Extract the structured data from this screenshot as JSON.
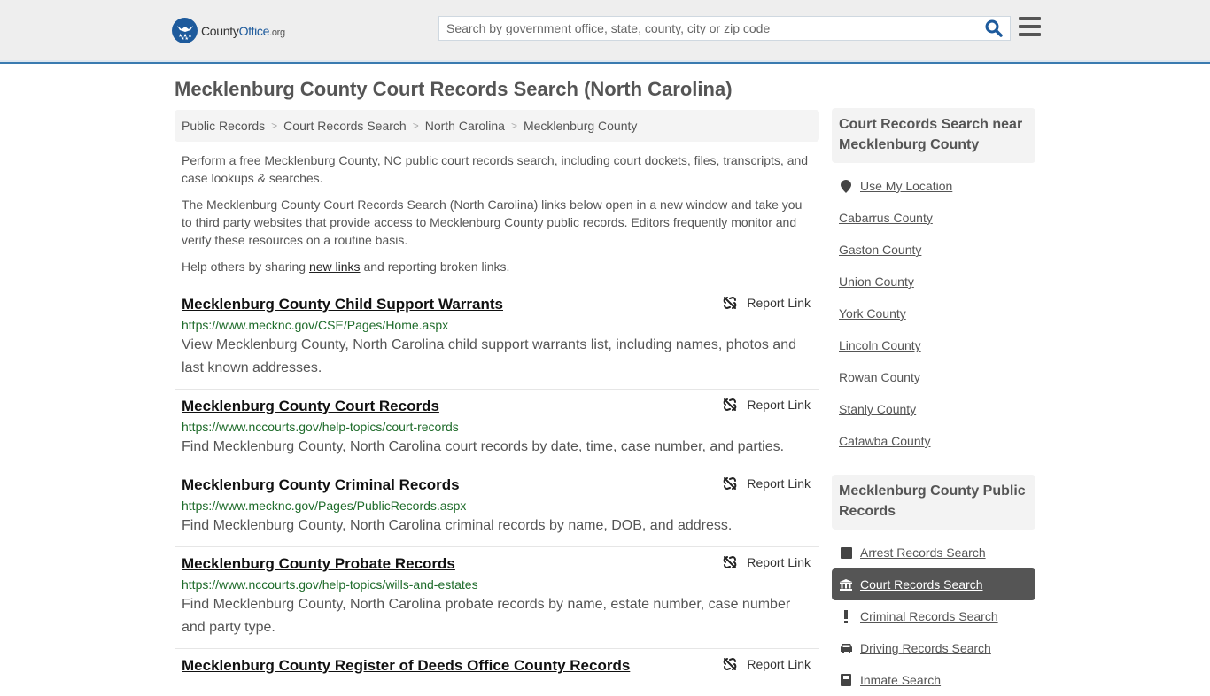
{
  "header": {
    "logo": {
      "name": "County",
      "name_accent": "Office",
      "tld": ".org"
    },
    "search": {
      "placeholder": "Search by government office, state, county, city or zip code",
      "value": ""
    },
    "colors": {
      "brand": "#1d5a9c",
      "header_border": "#3a7bb0"
    }
  },
  "page": {
    "title": "Mecklenburg County Court Records Search (North Carolina)"
  },
  "breadcrumb": [
    {
      "label": "Public Records"
    },
    {
      "label": "Court Records Search"
    },
    {
      "label": "North Carolina"
    },
    {
      "label": "Mecklenburg County"
    }
  ],
  "intro": {
    "p1": "Perform a free Mecklenburg County, NC public court records search, including court dockets, files, transcripts, and case lookups & searches.",
    "p2": "The Mecklenburg County Court Records Search (North Carolina) links below open in a new window and take you to third party websites that provide access to Mecklenburg County public records. Editors frequently monitor and verify these resources on a routine basis.",
    "p3_before": "Help others by sharing ",
    "p3_link": "new links",
    "p3_after": " and reporting broken links."
  },
  "results": [
    {
      "title": "Mecklenburg County Child Support Warrants",
      "url": "https://www.mecknc.gov/CSE/Pages/Home.aspx",
      "description": "View Mecklenburg County, North Carolina child support warrants list, including names, photos and last known addresses.",
      "report_label": "Report Link"
    },
    {
      "title": "Mecklenburg County Court Records",
      "url": "https://www.nccourts.gov/help-topics/court-records",
      "description": "Find Mecklenburg County, North Carolina court records by date, time, case number, and parties.",
      "report_label": "Report Link"
    },
    {
      "title": "Mecklenburg County Criminal Records",
      "url": "https://www.mecknc.gov/Pages/PublicRecords.aspx",
      "description": "Find Mecklenburg County, North Carolina criminal records by name, DOB, and address.",
      "report_label": "Report Link"
    },
    {
      "title": "Mecklenburg County Probate Records",
      "url": "https://www.nccourts.gov/help-topics/wills-and-estates",
      "description": "Find Mecklenburg County, North Carolina probate records by name, estate number, case number and party type.",
      "report_label": "Report Link"
    },
    {
      "title": "Mecklenburg County Register of Deeds Office County Records",
      "url": "",
      "description": "",
      "report_label": "Report Link"
    }
  ],
  "sidebar": {
    "nearby": {
      "heading": "Court Records Search near Mecklenburg County",
      "use_location": "Use My Location",
      "counties": [
        "Cabarrus County",
        "Gaston County",
        "Union County",
        "York County",
        "Lincoln County",
        "Rowan County",
        "Stanly County",
        "Catawba County"
      ]
    },
    "public_records": {
      "heading": "Mecklenburg County Public Records",
      "items": [
        {
          "label": "Arrest Records Search",
          "icon": "square-icon",
          "active": false
        },
        {
          "label": "Court Records Search",
          "icon": "courthouse-icon",
          "active": true
        },
        {
          "label": "Criminal Records Search",
          "icon": "exclamation-icon",
          "active": false
        },
        {
          "label": "Driving Records Search",
          "icon": "car-icon",
          "active": false
        },
        {
          "label": "Inmate Search",
          "icon": "inmate-icon",
          "active": false
        }
      ]
    }
  }
}
